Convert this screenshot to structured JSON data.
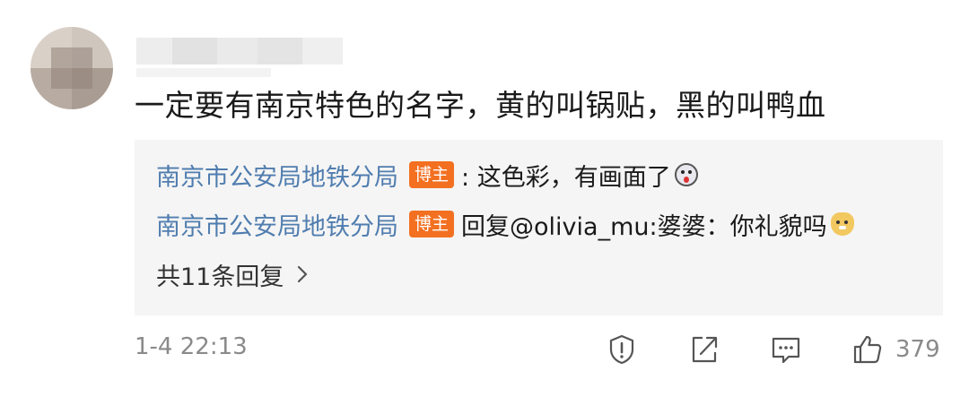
{
  "comment": {
    "text": "一定要有南京特色的名字，黄的叫锅贴，黑的叫鸭血",
    "timestamp": "1-4 22:13",
    "likes": "379"
  },
  "replies": [
    {
      "author": "南京市公安局地铁分局",
      "badge": "博主",
      "text": ": 这色彩，有画面了",
      "emoji": "shocked-face-icon"
    },
    {
      "author": "南京市公安局地铁分局",
      "badge": "博主",
      "text": "回复@olivia_mu:婆婆：你礼貌吗",
      "emoji": "doge-face-icon"
    }
  ],
  "more_replies_label": "共11条回复",
  "icons": {
    "report": "report-icon",
    "share": "share-icon",
    "comment": "comment-icon",
    "like": "thumbs-up-icon"
  },
  "colors": {
    "author_link": "#507daf",
    "badge": "#f37021",
    "reply_bg": "#f5f5f5",
    "meta_text": "#8a8a8a"
  }
}
